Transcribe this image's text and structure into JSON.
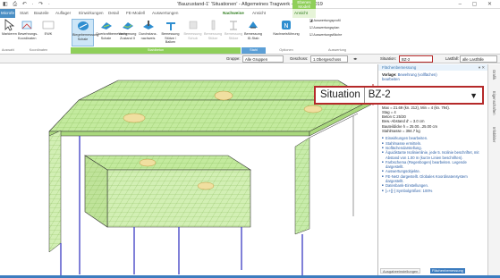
{
  "window": {
    "title": "'Bauzustand-1' 'Situationen' - Allgemeines Tragwerk - Microfe 2019",
    "context_tab": "Ebenes\nModell",
    "quick_access": "◧ ⎙ ↶ · ↷ ·",
    "controls": "–  ▢  ✕"
  },
  "tabs": [
    {
      "label": "Microfe"
    },
    {
      "label": "Start"
    },
    {
      "label": "Bauteile"
    },
    {
      "label": "Auflager"
    },
    {
      "label": "Einwirkungen"
    },
    {
      "label": "Detail"
    },
    {
      "label": "FE-Modell"
    },
    {
      "label": "Auswertungen"
    },
    {
      "label": "Nachweise"
    },
    {
      "label": "Ansicht"
    },
    {
      "label": "Ansicht"
    }
  ],
  "ribbon": {
    "buttons": [
      {
        "label": "Markieren"
      },
      {
        "label": "Bewehrungs-\nKoordinaten"
      },
      {
        "label": "EWK"
      },
      {
        "label": "Biegebemessung\nSchale"
      },
      {
        "label": "Querkraftbemessung\nSchale"
      },
      {
        "label": "Verformung\nZustand II"
      },
      {
        "label": "Durchstanz-\nnachweis"
      },
      {
        "label": "Bemessung\nStütze / Balken"
      },
      {
        "label": "Bemessung\nSchub"
      },
      {
        "label": "Bemessung\nStütze"
      },
      {
        "label": "Bemessung\nStütze"
      },
      {
        "label": "Bemessung\nID-Stab"
      },
      {
        "label": "Nachweisführung"
      }
    ],
    "right_items": [
      {
        "label": "Auswertungsprofil"
      },
      {
        "label": "Auswertungsplan"
      },
      {
        "label": "Auswertungsfläche"
      }
    ],
    "groups": [
      {
        "label": "Auswahl"
      },
      {
        "label": "Koordinaten"
      },
      {
        "label": "Stahlbeton"
      },
      {
        "label": "Stahl"
      },
      {
        "label": "Optionen"
      },
      {
        "label": "Auswertung"
      }
    ]
  },
  "options": {
    "gruppe_label": "Gruppe:",
    "gruppe_value": "Alle Gruppen",
    "geschoss_label": "Geschoss:",
    "geschoss_value": "1.Obergeschoss",
    "situation_label": "Situation:",
    "situation_value": "BZ-2",
    "lastfall_label": "Lastfall:",
    "lastfall_value": "alle Lastfälle"
  },
  "panel": {
    "header": "Flächenbemessung",
    "l1": "Vorlage:",
    "l1v": "Bewehrung (vollfächen)",
    "l1b": "bearbeiten",
    "values": [
      "Max = 21.69 (kn. 212), Min = 4 (kn. 794).",
      "Stag = 4",
      "Beton C 25/30",
      "Bew.-Abstand d' = 3.0 cm",
      "Bauteildicke h = 25.00...25.00 cm",
      "Stahlmasse = 394.7 kg"
    ],
    "bullets": [
      "Einwirkungen bearbeiten.",
      "Stahlmasse ermitteln.",
      "Isoflächendarstellung.",
      "Äquidistante Isolinienlinie, jede 5. Isolinie beschriftet, mit Abstand von 1.00 m (kurze Linien beschriften).",
      "Farbschema (Regenbogen) bearbeiten. Legende dargestellt.",
      "Auswertungsobjekte.",
      "FE-Netz dargestellt. Globales Koordinatensystem dargestellt.",
      "Datenbank-Einstellungen.",
      "[=+][-] Symbolgrößen: 100%"
    ],
    "tab1": "Ausgabeeinstellungen",
    "tab2": "Flächenbemessung"
  },
  "zoom": {
    "label": "Situation",
    "value": "BZ-2",
    "chevron": "▼"
  },
  "vtabs": [
    {
      "label": "Grafik"
    },
    {
      "label": "Eigenschaften"
    },
    {
      "label": "Infobilder"
    }
  ],
  "colors": {
    "accent": "#8fcf5a",
    "highlight": "#b52a2a",
    "slab": "#bfe89a"
  }
}
